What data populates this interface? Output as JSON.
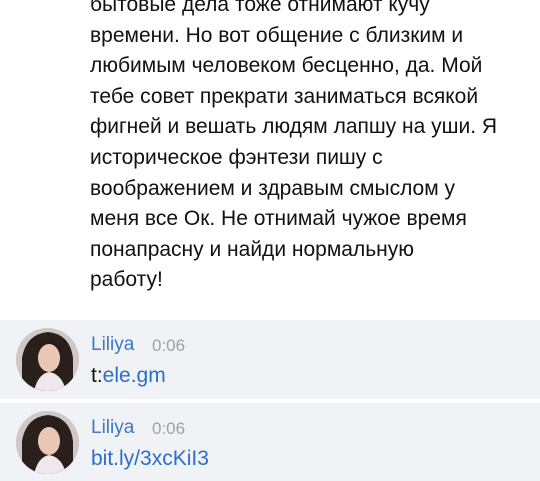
{
  "messages": [
    {
      "text": "бытовые дела тоже отнимают кучу\nвремени. Но вот общение с близким и\nлюбимым человеком бесценно, да. Мой\nтебе совет прекрати заниматься всякой\nфигней и вешать людям лапшу на уши. Я\nисторическое фэнтези пишу с\nвоображением и здравым смыслом у\nменя все Ок. Не отнимай чужое время\nпонапрасну и найди нормальную\nработу!"
    },
    {
      "author": "Liliya",
      "time": "0:06",
      "text_prefix": "t:",
      "text_link": "ele.gm",
      "avatar_icon": "user-avatar-photo"
    },
    {
      "author": "Liliya",
      "time": "0:06",
      "link": "bit.ly/3xcKiI3",
      "avatar_icon": "user-avatar-photo"
    }
  ],
  "colors": {
    "author": "#3a79c6",
    "link": "#2a6fc9",
    "time": "#9aa2ab",
    "highlight_bg": "#f0f2f5"
  }
}
